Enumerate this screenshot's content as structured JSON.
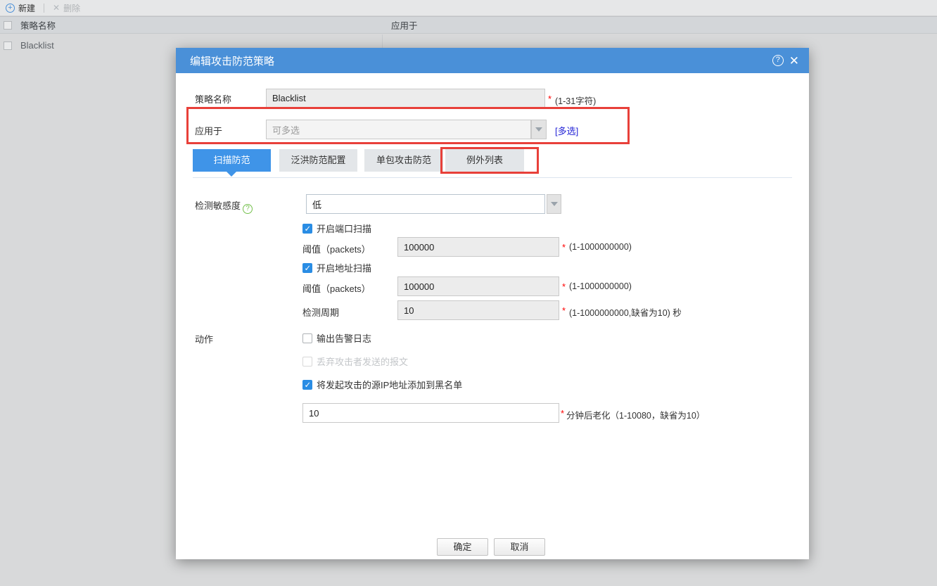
{
  "background": {
    "toolbar": {
      "new_label": "新建",
      "delete_label": "删除",
      "plus_glyph": "+",
      "x_glyph": "✕"
    },
    "table": {
      "col_policy_name": "策略名称",
      "col_apply_to": "应用于",
      "row1_name": "Blacklist"
    }
  },
  "modal": {
    "title": "编辑攻击防范策略",
    "help_glyph": "?",
    "close_glyph": "✕",
    "policy_name": {
      "label": "策略名称",
      "value": "Blacklist",
      "required": "*",
      "hint": "(1-31字符)"
    },
    "apply_to": {
      "label": "应用于",
      "placeholder": "可多选",
      "link": "[多选]"
    },
    "tabs": [
      {
        "label": "扫描防范"
      },
      {
        "label": "泛洪防范配置"
      },
      {
        "label": "单包攻击防范"
      },
      {
        "label": "例外列表"
      }
    ],
    "scan": {
      "sensitivity_label": "检测敏感度",
      "sensitivity_help_glyph": "?",
      "sensitivity_value": "低",
      "port_scan_label": "开启端口扫描",
      "port_threshold": {
        "label": "阈值（packets）",
        "value": "100000",
        "required": "*",
        "hint": "(1-1000000000)"
      },
      "addr_scan_label": "开启地址扫描",
      "addr_threshold": {
        "label": "阈值（packets）",
        "value": "100000",
        "required": "*",
        "hint": "(1-1000000000)"
      },
      "period": {
        "label": "检测周期",
        "value": "10",
        "required": "*",
        "hint": "(1-1000000000,缺省为10) 秒"
      }
    },
    "action": {
      "label": "动作",
      "log_label": "输出告警日志",
      "drop_label": "丢弃攻击者发送的报文",
      "blacklist_label": "将发起攻击的源IP地址添加到黑名单",
      "age": {
        "value": "10",
        "required": "*",
        "hint": "分钟后老化（1-10080，缺省为10）"
      }
    },
    "ok_label": "确定",
    "cancel_label": "取消"
  },
  "colors": {
    "accent_blue": "#4a90d8",
    "active_tab_blue": "#3f94e8",
    "checkbox_blue": "#2a8de4",
    "annotation_red": "#e8403a",
    "link_blue": "#2323d6",
    "help_green": "#74c04c"
  }
}
